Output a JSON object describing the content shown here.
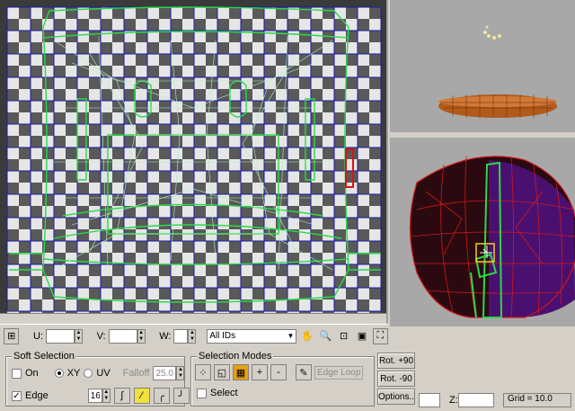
{
  "uv_toolbar": {
    "u_label": "U:",
    "v_label": "V:",
    "w_label": "W:",
    "u_value": "",
    "v_value": "",
    "w_value": "",
    "ids_select": "All IDs"
  },
  "soft_selection": {
    "title": "Soft Selection",
    "on_label": "On",
    "xy_label": "XY",
    "uv_label": "UV",
    "falloff_label": "Falloff",
    "falloff_value": "25.0",
    "edge_label": "Edge",
    "edge_value": "16",
    "on_checked": false,
    "edge_checked": true,
    "mode": "XY"
  },
  "selection_modes": {
    "title": "Selection Modes",
    "plus_label": "+",
    "minus_label": "-",
    "edge_loop_label": "Edge Loop",
    "select_label": "Select"
  },
  "side_buttons": {
    "rot_plus": "Rot. +90",
    "rot_minus": "Rot. -90",
    "options": "Options.."
  },
  "status_bar": {
    "z_label": "Z:",
    "grid_label": "Grid = 10.0"
  },
  "colors": {
    "uv_green": "#2bd94a",
    "uv_blue": "#1a1aa8",
    "selected_red": "#e01010",
    "mesh_red": "#d01818",
    "mesh_purple": "#4a1070",
    "ring_brown": "#b25a1a"
  }
}
